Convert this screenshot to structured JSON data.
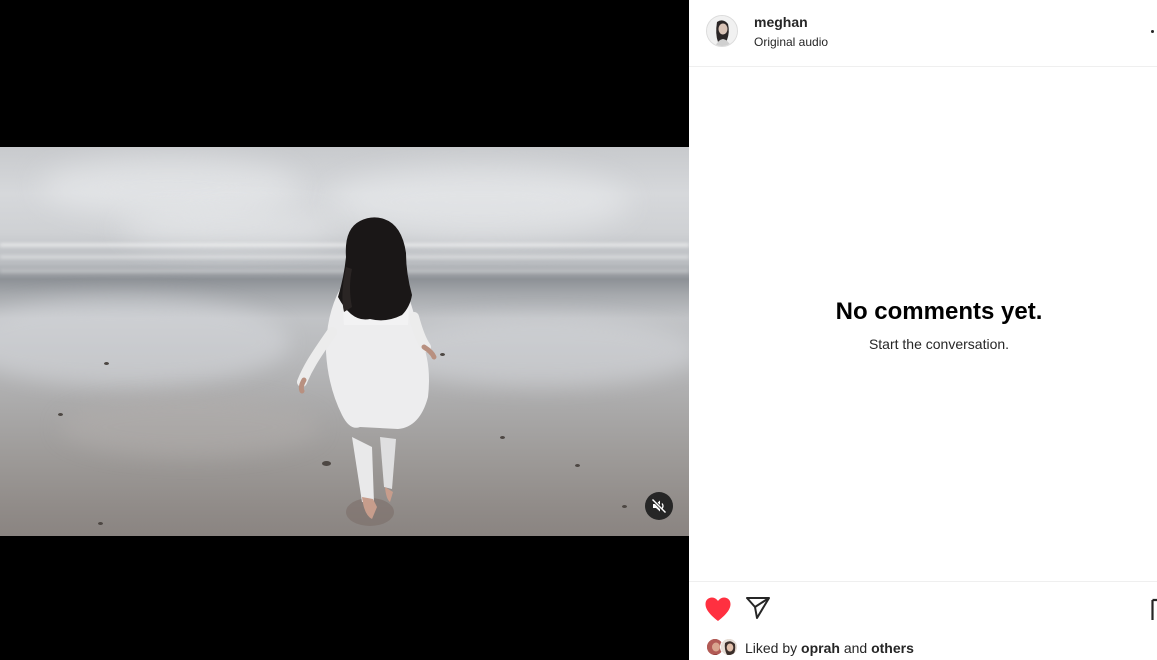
{
  "post": {
    "username": "meghan",
    "audio_label": "Original audio"
  },
  "comments": {
    "empty_title": "No comments yet.",
    "empty_subtitle": "Start the conversation."
  },
  "likes": {
    "prefix": "Liked by",
    "first_user": "oprah",
    "joiner": "and",
    "others": "others",
    "liked": true
  },
  "icons": {
    "like": "heart-icon",
    "share": "paper-plane-icon",
    "save": "bookmark-icon",
    "mute": "speaker-muted-icon",
    "more": "more-options-icon"
  },
  "colors": {
    "like_red": "#ff3040",
    "text": "#262626",
    "divider": "#efefef"
  }
}
